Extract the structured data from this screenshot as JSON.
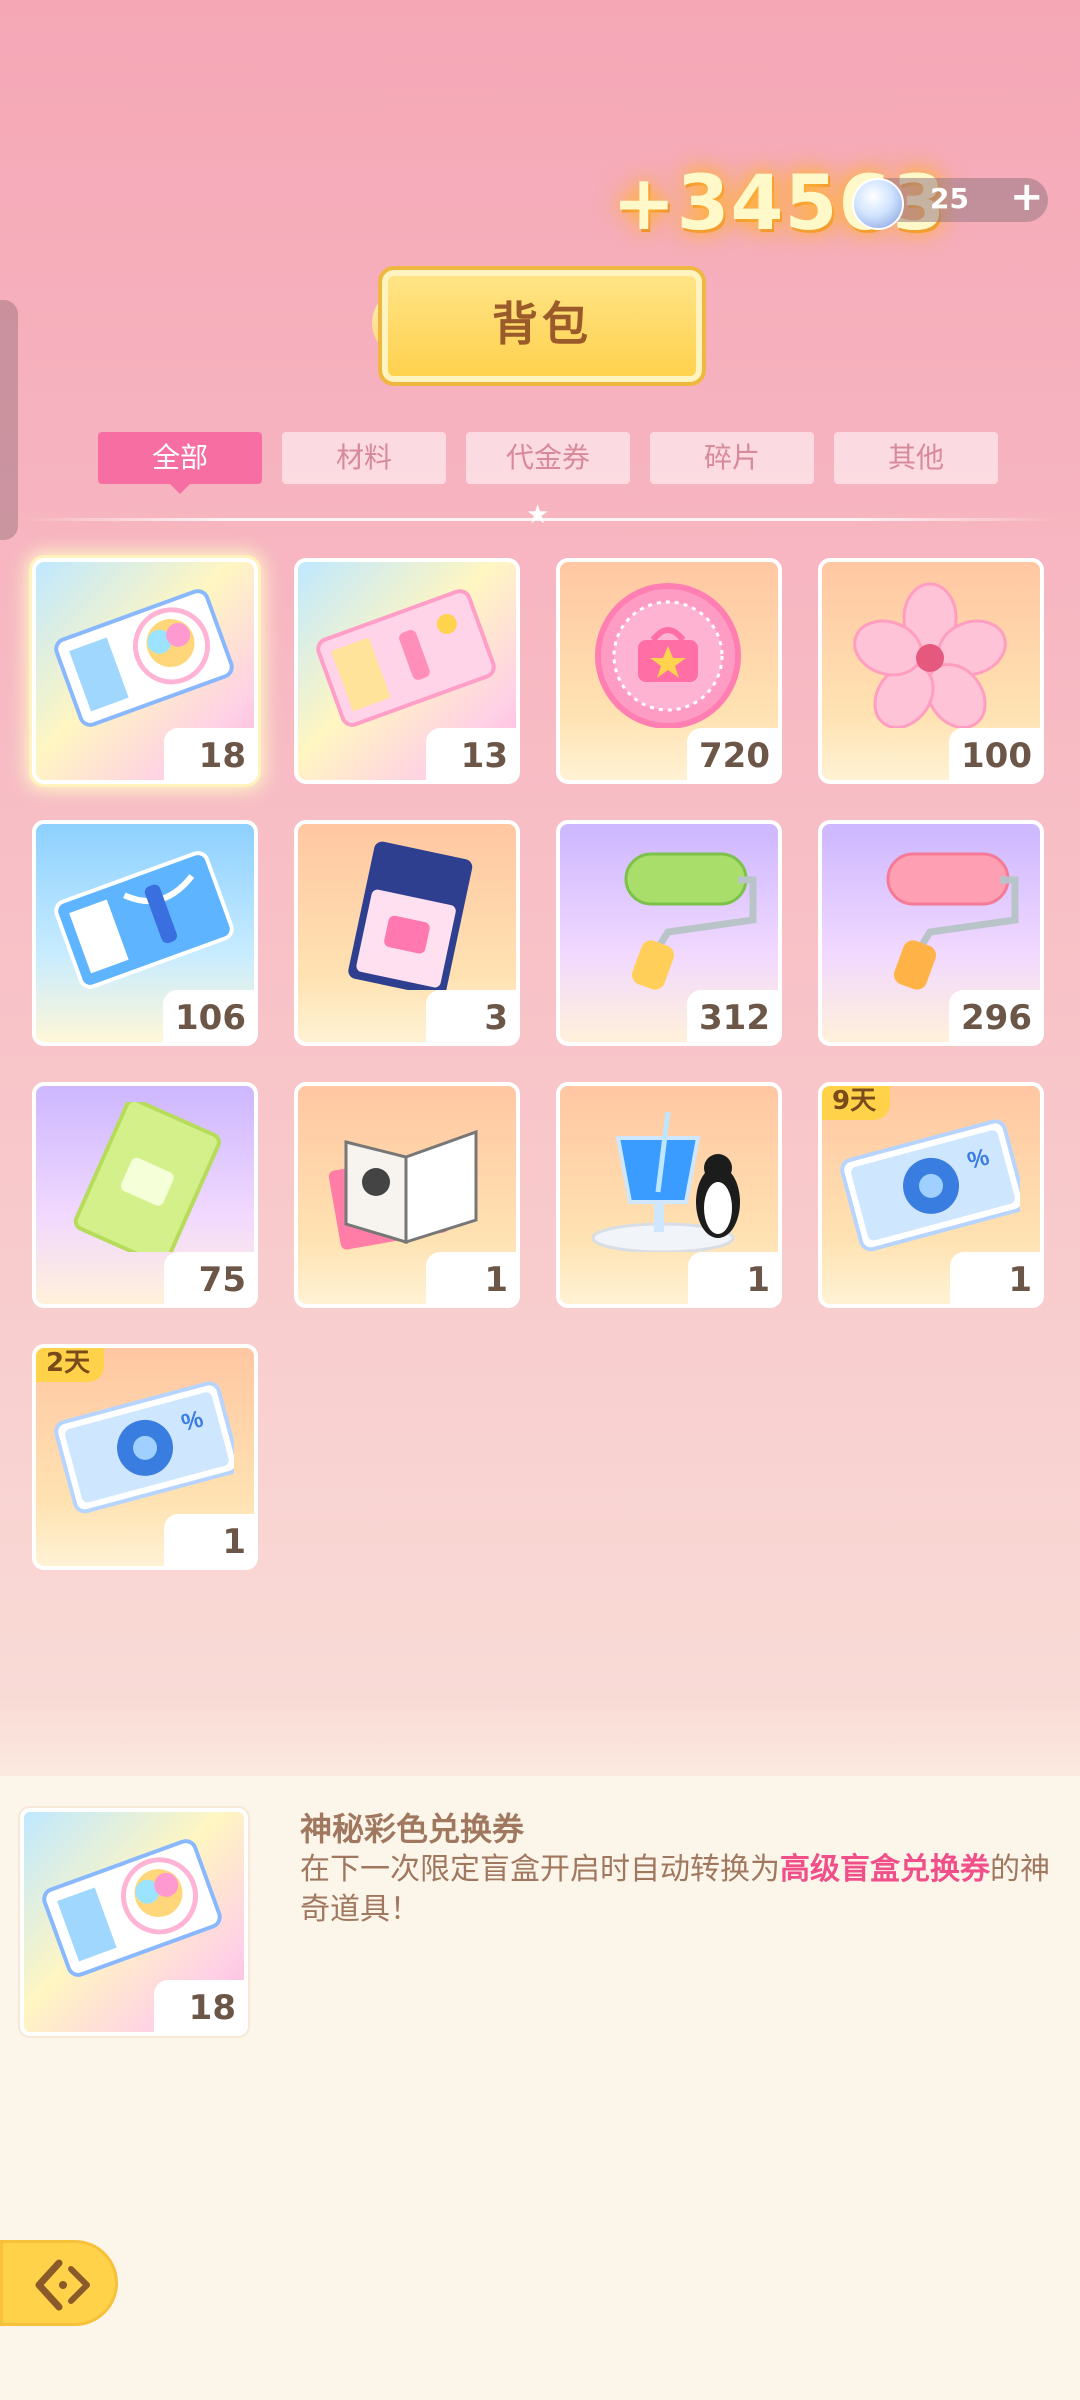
{
  "currency": {
    "bonus": "+34563",
    "gems": "25",
    "gem_icon": "snowflake-gem-icon",
    "plus_label": "+"
  },
  "title": "背包",
  "tabs": [
    "全部",
    "材料",
    "代金券",
    "碎片",
    "其他"
  ],
  "active_tab": "全部",
  "items": [
    {
      "name": "rainbow-ticket",
      "count": "18",
      "icon": "rainbow-ticket-icon",
      "bg": "rainbow",
      "selected": true
    },
    {
      "name": "pink-ticket",
      "count": "13",
      "icon": "pink-ticket-icon",
      "bg": "rainbow"
    },
    {
      "name": "pink-coin",
      "count": "720",
      "icon": "pink-coin-icon",
      "bg": "peach"
    },
    {
      "name": "sakura-flower",
      "count": "100",
      "icon": "sakura-flower-icon",
      "bg": "peach"
    },
    {
      "name": "blue-ticket",
      "count": "106",
      "icon": "blue-ticket-icon",
      "bg": "sky"
    },
    {
      "name": "navy-ticket",
      "count": "3",
      "icon": "navy-ticket-icon",
      "bg": "peach"
    },
    {
      "name": "green-paint-roller",
      "count": "312",
      "icon": "green-roller-icon",
      "bg": "lavender"
    },
    {
      "name": "pink-paint-roller",
      "count": "296",
      "icon": "pink-roller-icon",
      "bg": "lavender"
    },
    {
      "name": "green-ticket",
      "count": "75",
      "icon": "green-ticket-icon",
      "bg": "lavender"
    },
    {
      "name": "sketch-book",
      "count": "1",
      "icon": "book-icon",
      "bg": "peach"
    },
    {
      "name": "penguin-drink",
      "count": "1",
      "icon": "penguin-drink-icon",
      "bg": "peach"
    },
    {
      "name": "sale-coupon",
      "count": "1",
      "icon": "sale-coupon-icon",
      "bg": "peach",
      "badge": "9天"
    },
    {
      "name": "sale-coupon-2",
      "count": "1",
      "icon": "sale-coupon-icon",
      "bg": "peach",
      "badge": "2天"
    }
  ],
  "detail": {
    "name": "神秘彩色兑换券",
    "desc_before": "在下一次限定盲盒开启时自动转换为",
    "desc_highlight": "高级盲盒兑换券",
    "desc_after": "的神奇道具！",
    "count": "18",
    "icon": "rainbow-ticket-icon"
  },
  "back_icon": "back-arrow-icon",
  "colors": {
    "accent_pink": "#f76ea2",
    "highlight_text": "#f04f8a",
    "gold": "#ffd24a"
  }
}
